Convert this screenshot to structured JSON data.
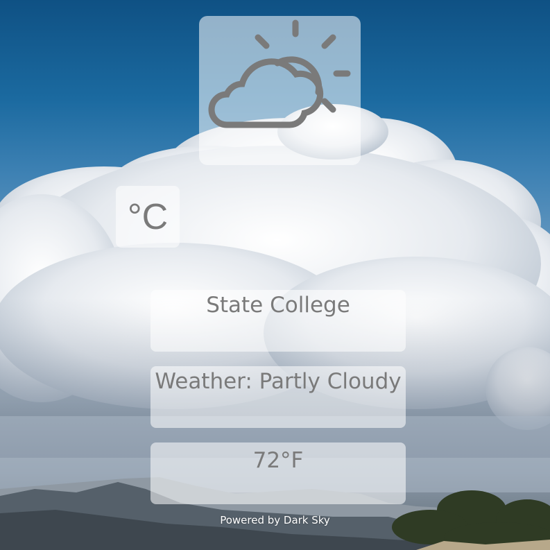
{
  "weather": {
    "icon": "partly-cloudy-day-icon",
    "unit_toggle_label": "°C",
    "location": "State College",
    "summary": "Weather: Partly Cloudy",
    "temperature": "72°F"
  },
  "footer": {
    "powered_by": "Powered by Dark Sky"
  },
  "colors": {
    "panel_text": "#7a7a7a",
    "sky": "#0f5184",
    "footer_text": "#ffffff"
  }
}
